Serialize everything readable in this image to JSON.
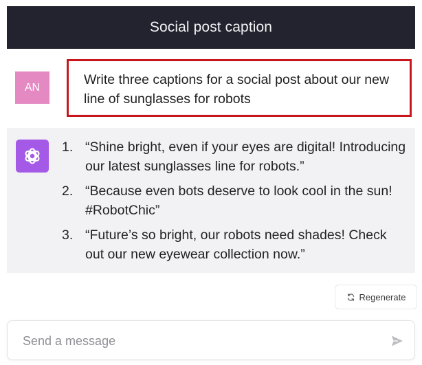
{
  "header": {
    "title": "Social post caption"
  },
  "user_message": {
    "avatar_initials": "AN",
    "text": "Write three captions for a social post about our new line of sunglasses for robots"
  },
  "assistant_message": {
    "items": [
      {
        "num": "1.",
        "text": "“Shine bright, even if your eyes are digital! Introducing our latest sunglasses line for robots.”"
      },
      {
        "num": "2.",
        "text": "“Because even bots deserve to look cool in the sun! #RobotChic”"
      },
      {
        "num": "3.",
        "text": "“Future’s so bright, our robots need shades! Check out our new eyewear collection now.”"
      }
    ]
  },
  "regenerate": {
    "label": "Regenerate",
    "icon": "refresh-icon"
  },
  "composer": {
    "placeholder": "Send a message",
    "send_icon": "send-icon"
  },
  "colors": {
    "header_bg": "#23232f",
    "user_avatar": "#e489c2",
    "bot_avatar": "#a45ae6",
    "highlight_border": "#c8161d",
    "assistant_bg": "#f2f2f5"
  }
}
